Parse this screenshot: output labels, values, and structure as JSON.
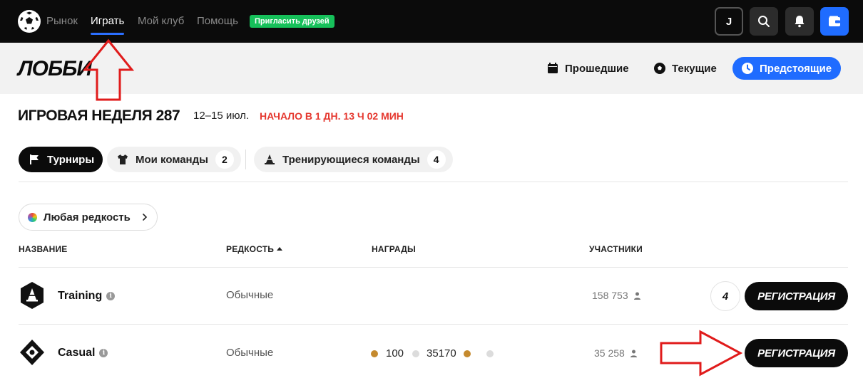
{
  "nav": {
    "links": [
      "Рынок",
      "Играть",
      "Мой клуб",
      "Помощь"
    ],
    "active": "Играть",
    "invite_label": "Пригласить друзей",
    "avatar_initial": "J"
  },
  "lobby": {
    "title": "ЛОББИ",
    "segments": {
      "past": "Прошедшие",
      "current": "Текущие",
      "upcoming": "Предстоящие"
    }
  },
  "gameweek": {
    "title": "ИГРОВАЯ НЕДЕЛЯ 287",
    "dates": "12–15 июл.",
    "countdown": "НАЧАЛО В 1 ДН. 13 Ч 02 МИН"
  },
  "filters": {
    "tournaments_label": "Турниры",
    "my_teams_label": "Мои команды",
    "my_teams_count": "2",
    "training_label": "Тренирующиеся команды",
    "training_count": "4",
    "rarity_label": "Любая редкость"
  },
  "table": {
    "headers": {
      "name": "НАЗВАНИЕ",
      "rarity": "РЕДКОСТЬ",
      "rewards": "НАГРАДЫ",
      "participants": "УЧАСТНИКИ"
    },
    "rows": [
      {
        "name": "Training",
        "rarity": "Обычные",
        "participants": "158 753",
        "entered_count": "4",
        "action": "РЕГИСТРАЦИЯ"
      },
      {
        "name": "Casual",
        "rarity": "Обычные",
        "rewards": [
          "100",
          "35170"
        ],
        "participants": "35 258",
        "action": "РЕГИСТРАЦИЯ"
      }
    ]
  },
  "colors": {
    "accent_blue": "#1f6cff",
    "invite_green": "#16c05a",
    "countdown_red": "#e5382f",
    "annotation_red": "#e01b1b"
  }
}
